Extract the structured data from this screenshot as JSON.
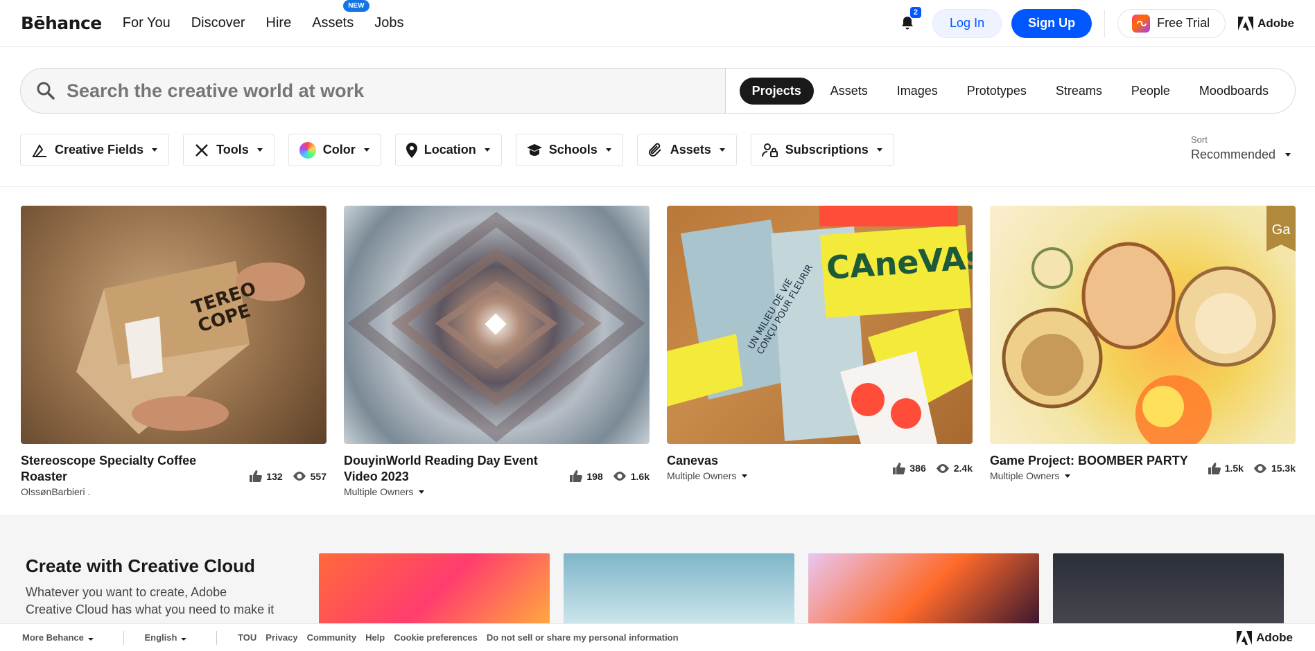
{
  "header": {
    "logo": "Bēhance",
    "nav": [
      "For You",
      "Discover",
      "Hire",
      "Assets",
      "Jobs"
    ],
    "new_badge": "NEW",
    "notifications_count": "2",
    "login": "Log In",
    "signup": "Sign Up",
    "free_trial": "Free Trial",
    "adobe": "Adobe"
  },
  "search": {
    "placeholder": "Search the creative world at work",
    "tabs": [
      "Projects",
      "Assets",
      "Images",
      "Prototypes",
      "Streams",
      "People",
      "Moodboards"
    ],
    "active_tab": "Projects"
  },
  "filters": [
    "Creative Fields",
    "Tools",
    "Color",
    "Location",
    "Schools",
    "Assets",
    "Subscriptions"
  ],
  "sort": {
    "label": "Sort",
    "value": "Recommended"
  },
  "projects": [
    {
      "title": "Stereoscope Specialty Coffee Roaster",
      "owner": "OlssønBarbieri .",
      "likes": "132",
      "views": "557",
      "owner_dropdown": false
    },
    {
      "title": "DouyinWorld Reading Day Event Video 2023",
      "owner": "Multiple Owners",
      "likes": "198",
      "views": "1.6k",
      "owner_dropdown": true
    },
    {
      "title": "Canevas",
      "owner": "Multiple Owners",
      "likes": "386",
      "views": "2.4k",
      "owner_dropdown": true
    },
    {
      "title": "Game Project: BOOMBER PARTY",
      "owner": "Multiple Owners",
      "likes": "1.5k",
      "views": "15.3k",
      "owner_dropdown": true
    }
  ],
  "thumbnail_text": {
    "card1": "TEREO COPE",
    "card3": "CAneVAs",
    "card3_side": "UN MILIEU DE VIE CONÇU POUR FLEURIR",
    "card4_badge": "Ga"
  },
  "creative_cloud": {
    "title": "Create with Creative Cloud",
    "description": "Whatever you want to create, Adobe Creative Cloud has what you need to make it"
  },
  "footer": {
    "more": "More Behance",
    "language": "English",
    "links": [
      "TOU",
      "Privacy",
      "Community",
      "Help",
      "Cookie preferences",
      "Do not sell or share my personal information"
    ],
    "adobe": "Adobe"
  }
}
